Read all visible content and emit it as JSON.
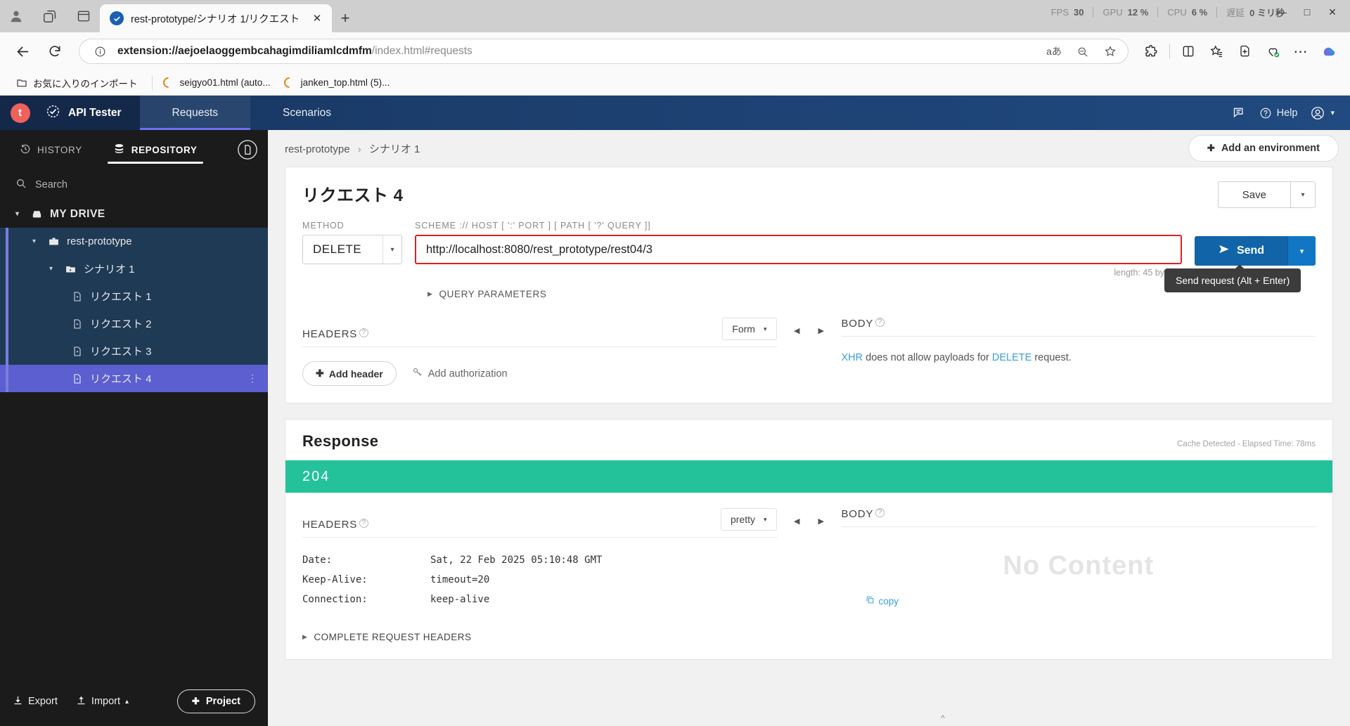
{
  "browser": {
    "tab": {
      "title": "rest-prototype/シナリオ 1/リクエスト",
      "favicon": "shield-check-icon",
      "close": "✕"
    },
    "new_tab": "+",
    "perf": [
      {
        "label": "FPS",
        "value": "30"
      },
      {
        "label": "GPU",
        "value": "12 %"
      },
      {
        "label": "CPU",
        "value": "6 %"
      },
      {
        "label": "遅延",
        "value": "0 ミリ秒"
      }
    ],
    "window_controls": {
      "minimize": "—",
      "maximize": "□",
      "close": "✕"
    },
    "address": {
      "url_bold": "extension://aejoelaoggembcahagimdiliamlcdmfm",
      "url_rest": "/index.html#requests",
      "info_icon": "info-circle-icon",
      "translate": "aあ",
      "zoom": "zoom-out-icon",
      "favorite": "star-icon"
    },
    "bookmarks": [
      {
        "label": "お気に入りのインポート",
        "icon": "import-folder-icon"
      },
      {
        "label": "seigyo01.html (auto...",
        "icon": "page-icon"
      },
      {
        "label": "janken_top.html (5)...",
        "icon": "page-icon"
      }
    ]
  },
  "app": {
    "logo": "t",
    "brand": "API Tester",
    "tabs": [
      {
        "label": "Requests",
        "active": true
      },
      {
        "label": "Scenarios",
        "active": false
      }
    ],
    "header_right": {
      "feedback": "feedback-icon",
      "help": "Help",
      "account": "account-icon",
      "chevron": "▾"
    }
  },
  "sidebar": {
    "tabs": [
      {
        "label": "HISTORY",
        "icon": "clock-icon",
        "active": false
      },
      {
        "label": "REPOSITORY",
        "icon": "database-icon",
        "active": true
      }
    ],
    "doc_button": "document-icon",
    "search_placeholder": "Search",
    "tree": [
      {
        "label": "MY DRIVE",
        "level": 1,
        "icon": "drive-icon",
        "caret": "▾",
        "selected": false
      },
      {
        "label": "rest-prototype",
        "level": 2,
        "icon": "project-icon",
        "caret": "▾",
        "selected": false
      },
      {
        "label": "シナリオ 1",
        "level": 3,
        "icon": "scenario-icon",
        "caret": "▾",
        "selected": false
      },
      {
        "label": "リクエスト 1",
        "level": 4,
        "icon": "request-icon",
        "caret": "",
        "selected": false
      },
      {
        "label": "リクエスト 2",
        "level": 4,
        "icon": "request-icon",
        "caret": "",
        "selected": false
      },
      {
        "label": "リクエスト 3",
        "level": 4,
        "icon": "request-icon",
        "caret": "",
        "selected": false
      },
      {
        "label": "リクエスト 4",
        "level": 4,
        "icon": "request-icon",
        "caret": "",
        "selected": true
      }
    ],
    "footer": {
      "export": "Export",
      "import": "Import",
      "import_caret": "▴",
      "project": "Project",
      "project_plus": "✚"
    }
  },
  "main": {
    "breadcrumb": {
      "root": "rest-prototype",
      "sep": "›",
      "current": "シナリオ 1"
    },
    "add_environment": "Add an environment",
    "add_environment_plus": "✚",
    "request": {
      "title": "リクエスト 4",
      "save_label": "Save",
      "save_caret": "▾",
      "method_label": "METHOD",
      "method_value": "DELETE",
      "url_label": "SCHEME :// HOST [ ':' PORT ] [ PATH [ '?' QUERY ]]",
      "url_value": "http://localhost:8080/rest_prototype/rest04/3",
      "length_note": "length: 45 byte(s)",
      "send_label": "Send",
      "send_tooltip": "Send request (Alt + Enter)",
      "query_parameters": "QUERY PARAMETERS",
      "headers_title": "HEADERS",
      "headers_format": "Form",
      "add_header": "Add header",
      "add_authorization": "Add authorization",
      "body_title": "BODY",
      "body_note_pre": "XHR",
      "body_note_mid": " does not allow payloads for ",
      "body_note_method": "DELETE",
      "body_note_post": " request."
    },
    "response": {
      "title": "Response",
      "meta": "Cache Detected - Elapsed Time: 78ms",
      "status": "204",
      "status_color": "#23c29b",
      "headers_title": "HEADERS",
      "headers_format": "pretty",
      "headers": [
        {
          "key": "Date:",
          "value": "Sat, 22 Feb 2025 05:10:48 GMT"
        },
        {
          "key": "Keep-Alive:",
          "value": "timeout=20"
        },
        {
          "key": "Connection:",
          "value": "keep-alive"
        }
      ],
      "complete_request_headers": "COMPLETE REQUEST HEADERS",
      "body_title": "BODY",
      "no_content": "No Content",
      "copy": "copy"
    }
  }
}
